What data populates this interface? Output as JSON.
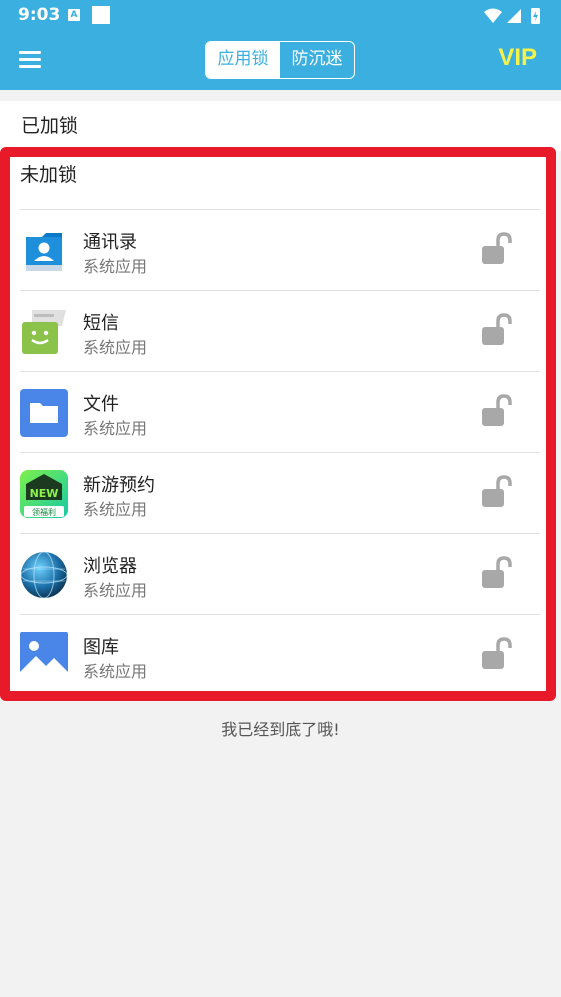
{
  "status_bar": {
    "time": "9:03",
    "notif_icon_letter": "A"
  },
  "app_bar": {
    "tabs": [
      {
        "label": "应用锁",
        "active": true
      },
      {
        "label": "防沉迷",
        "active": false
      }
    ],
    "vip_label": "VIP"
  },
  "sections": {
    "locked_title": "已加锁",
    "unlocked_title": "未加锁"
  },
  "apps": [
    {
      "name": "通讯录",
      "type": "系统应用",
      "icon": "contacts-icon"
    },
    {
      "name": "短信",
      "type": "系统应用",
      "icon": "messages-icon"
    },
    {
      "name": "文件",
      "type": "系统应用",
      "icon": "files-icon"
    },
    {
      "name": "新游预约",
      "type": "系统应用",
      "icon": "new-games-icon",
      "icon_text_top": "NEW",
      "icon_text_bottom": "领福利"
    },
    {
      "name": "浏览器",
      "type": "系统应用",
      "icon": "browser-icon"
    },
    {
      "name": "图库",
      "type": "系统应用",
      "icon": "gallery-icon"
    }
  ],
  "footer": "我已经到底了哦!",
  "colors": {
    "primary": "#3bb0e0",
    "vip": "#f7f24a",
    "highlight": "#e81a2a"
  }
}
